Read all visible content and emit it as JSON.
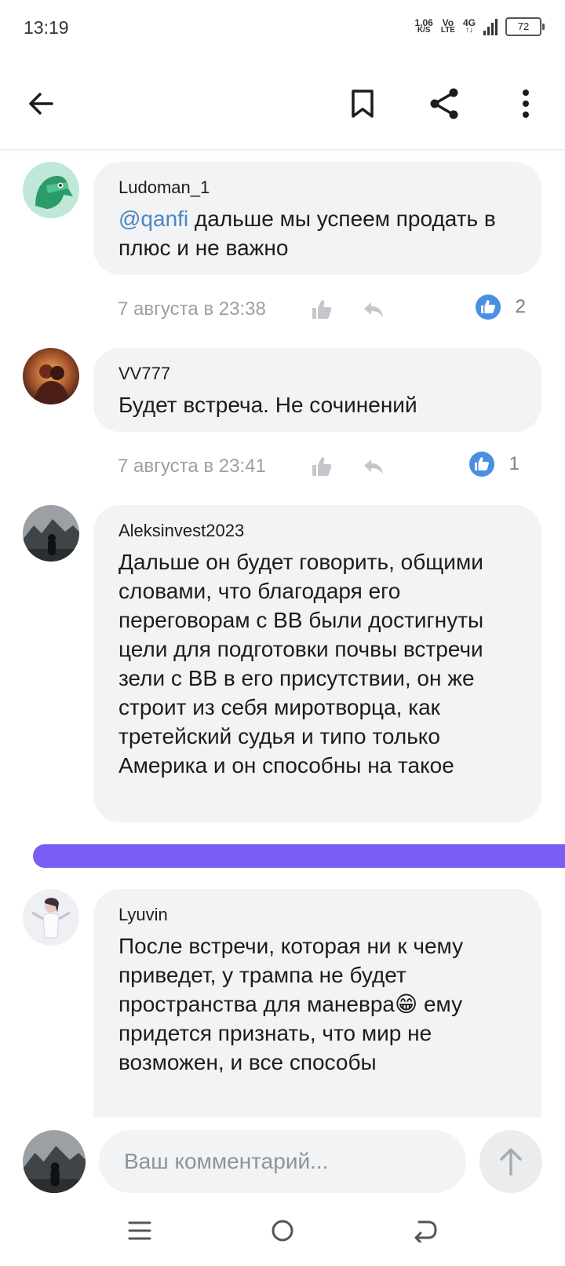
{
  "status_bar": {
    "time": "13:19",
    "net_speed_value": "1,06",
    "net_speed_unit": "K/S",
    "volte_top": "Vo",
    "volte_bottom": "LTE",
    "network_top": "4G",
    "network_bottom": "↑↓",
    "battery": "72"
  },
  "app_bar": {
    "back_icon": "arrow-left-icon",
    "bookmark_icon": "bookmark-icon",
    "share_icon": "share-icon",
    "more_icon": "more-vertical-icon"
  },
  "comments": [
    {
      "author": "Ludoman_1",
      "mention": "@qanfi",
      "text": " дальше мы успеем продать в плюс и не важно",
      "date": "7 августа в 23:38",
      "likes": "2"
    },
    {
      "author": "VV777",
      "text": "Будет встреча. Не сочинений",
      "date": "7 августа в 23:41",
      "likes": "1"
    },
    {
      "author": "Aleksinvest2023",
      "text": "Дальше он будет говорить, общими словами, что благодаря его переговорам с ВВ были достигнуты цели для подготовки почвы встречи зели с ВВ в его присутствии, он же строит из себя миротворца, как третейский судья и типо только Америка и он способны на такое"
    },
    {
      "author": "Lyuvin",
      "text": "После встречи, которая ни к чему приведет, у трампа не будет пространства для маневра😁 ему придется признать, что мир не возможен, и все способы"
    }
  ],
  "divider_color": "#7b5cf5",
  "comment_input": {
    "placeholder": "Ваш комментарий..."
  },
  "colors": {
    "like_blue": "#4a8fe0",
    "mention_blue": "#4a86c8",
    "bubble_bg": "#f2f3f5"
  }
}
